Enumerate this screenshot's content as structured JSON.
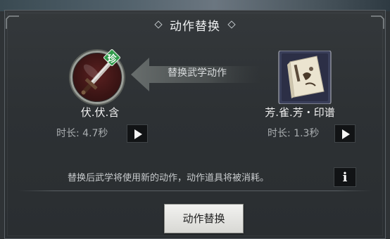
{
  "dialog": {
    "title": "动作替换",
    "arrow_label": "替换武学动作",
    "notice": "替换后武学将使用新的动作，动作道具将被消耗。",
    "action_button_label": "动作替换"
  },
  "left_item": {
    "name": "伏.伏.含",
    "duration": "时长: 4.7秒",
    "rarity_badge": "珍",
    "icon": "sword-icon",
    "play_icon": "play-icon"
  },
  "right_item": {
    "name": "芳.雀.芳・印谱",
    "duration": "时长: 1.3秒",
    "icon": "scroll-book-icon",
    "play_icon": "play-icon"
  },
  "colors": {
    "panel_bg": "#2f3336",
    "badge_green": "#2f9a4a",
    "item_red": "#5a2020",
    "button_light": "#e8e8e4"
  }
}
